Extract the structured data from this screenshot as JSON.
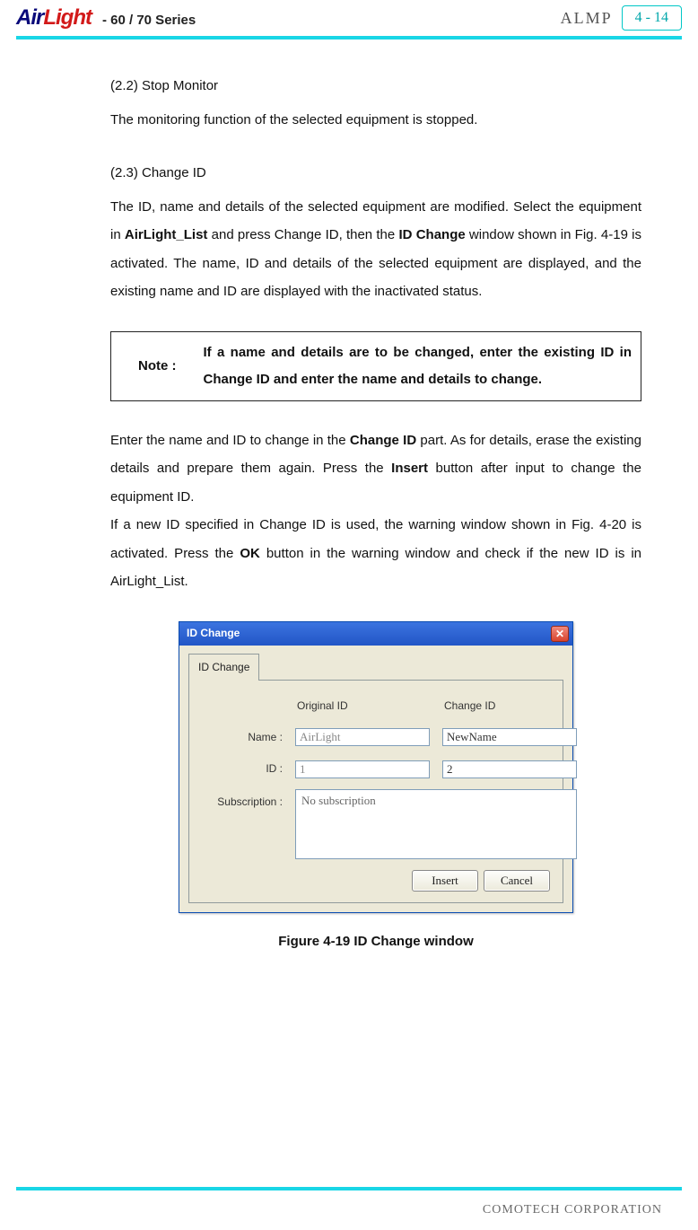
{
  "header": {
    "logo": {
      "part1": "Air",
      "part2": "Light"
    },
    "series": "- 60 / 70 Series",
    "almp": "ALMP",
    "page_num": "4 - 14"
  },
  "sections": {
    "s22_title": "(2.2) Stop Monitor",
    "s22_body": "The monitoring function of the selected equipment is stopped.",
    "s23_title": "(2.3) Change ID",
    "s23_body_pre": "The ID, name and details of the selected equipment are modified. Select the equipment in ",
    "s23_body_b1": "AirLight_List",
    "s23_body_mid": " and press Change ID, then the ",
    "s23_body_b2": "ID Change",
    "s23_body_post": " window shown in Fig. 4-19 is activated. The name, ID and details of the selected equipment are displayed, and the existing name and ID are displayed with the inactivated status."
  },
  "note": {
    "label": "Note :",
    "text": "If a name and details are to be changed, enter the existing ID in Change ID and enter the name and details to change."
  },
  "para2": {
    "pre": "Enter the name and ID to change in the ",
    "b1": "Change ID",
    "mid": " part. As for details, erase the existing details and prepare them again. Press the ",
    "b2": "Insert",
    "post": " button after input to change the equipment ID."
  },
  "para3": {
    "pre": " If a new ID specified in Change ID is used, the warning window shown in Fig. 4-20 is activated. Press the ",
    "b1": "OK",
    "post": " button in the warning window and check if the new ID is in AirLight_List."
  },
  "dialog": {
    "title": "ID Change",
    "tab": "ID Change",
    "col_original": "Original ID",
    "col_change": "Change ID",
    "label_name": "Name :",
    "label_id": "ID :",
    "label_sub": "Subscription :",
    "val_name_orig": "AirLight",
    "val_name_new": "NewName",
    "val_id_orig": "1",
    "val_id_new": "2",
    "val_sub": "No subscription",
    "btn_insert": "Insert",
    "btn_cancel": "Cancel"
  },
  "figure_caption": "Figure 4-19 ID Change window",
  "footer": "COMOTECH CORPORATION"
}
